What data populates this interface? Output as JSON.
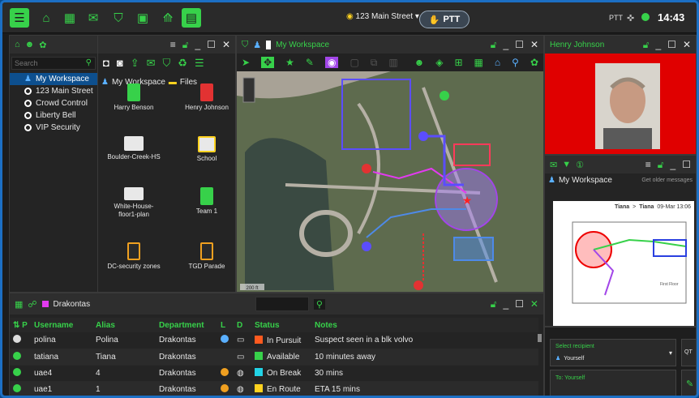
{
  "topbar": {
    "location": "123 Main Street",
    "ptt_label": "PTT",
    "ptt_small": "PTT",
    "clock": "14:43"
  },
  "tree": {
    "search_placeholder": "Search",
    "items": [
      {
        "label": "My Workspace",
        "selected": true
      },
      {
        "label": "123 Main Street"
      },
      {
        "label": "Crowd Control"
      },
      {
        "label": "Liberty Bell"
      },
      {
        "label": "VIP Security"
      }
    ]
  },
  "files": {
    "breadcrumb_root": "My Workspace",
    "breadcrumb_sep": ">",
    "breadcrumb_current": "Files",
    "tiles": [
      {
        "label": "Harry Benson",
        "kind": "person-green"
      },
      {
        "label": "Henry Johnson",
        "kind": "person-red"
      },
      {
        "label": "Boulder-Creek-HS",
        "kind": "map"
      },
      {
        "label": "School",
        "kind": "school"
      },
      {
        "label": "White-House-floor1-plan",
        "kind": "map"
      },
      {
        "label": "Team 1",
        "kind": "team"
      },
      {
        "label": "DC-security zones",
        "kind": "zones"
      },
      {
        "label": "TGD Parade",
        "kind": "zones"
      }
    ]
  },
  "map": {
    "title": "My Workspace",
    "scale": "200 ft"
  },
  "person": {
    "name": "Henry Johnson"
  },
  "chat": {
    "title": "My Workspace",
    "older": "Get older messages",
    "from": "Tiana",
    "arrow": ">",
    "to": "Tiana",
    "date": "09-Mar 13:06",
    "floor_label": "First Floor",
    "select_recipient": "Select recipient",
    "recipient": "Yourself",
    "to_label": "To: Yourself",
    "qt": "QT"
  },
  "team": {
    "name": "Drakontas",
    "columns": [
      "P",
      "Username",
      "Alias",
      "Department",
      "L",
      "D",
      "Status",
      "Notes"
    ],
    "rows": [
      {
        "presence": "#dddddd",
        "username": "polina",
        "alias": "Polina",
        "department": "Drakontas",
        "status": "In Pursuit",
        "status_color": "#ff5a1f",
        "notes": "Suspect seen in a blk volvo"
      },
      {
        "presence": "#37d14a",
        "username": "tatiana",
        "alias": "Tiana",
        "department": "Drakontas",
        "status": "Available",
        "status_color": "#37d14a",
        "notes": "10 minutes away"
      },
      {
        "presence": "#37d14a",
        "username": "uae4",
        "alias": "4",
        "department": "Drakontas",
        "status": "On Break",
        "status_color": "#22d3e6",
        "notes": "30 mins"
      },
      {
        "presence": "#37d14a",
        "username": "uae1",
        "alias": "1",
        "department": "Drakontas",
        "status": "En Route",
        "status_color": "#ffd21f",
        "notes": "ETA 15 mins"
      }
    ]
  },
  "colors": {
    "accent": "#37d14a",
    "frame": "#1c6fc4",
    "danger": "#ff0000"
  }
}
